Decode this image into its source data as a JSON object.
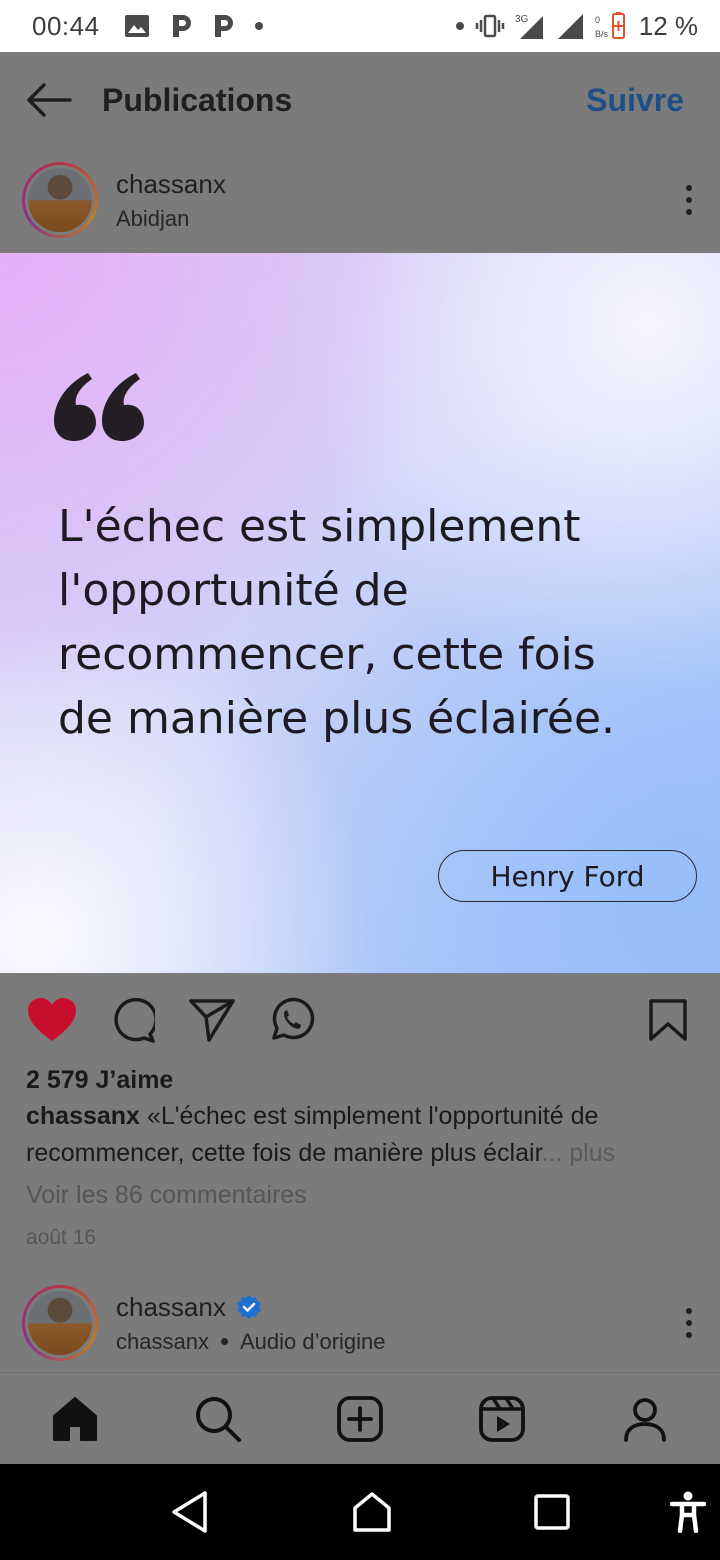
{
  "status_bar": {
    "time": "00:44",
    "battery_percent": "12 %",
    "network": "3G",
    "data_speed": "0 B/s",
    "icons": [
      "gallery-icon",
      "p-app-icon",
      "p-app-icon",
      "dot-icon",
      "vibrate-icon",
      "signal-icon",
      "battery-icon"
    ]
  },
  "header": {
    "title": "Publications",
    "follow_label": "Suivre"
  },
  "post": {
    "username": "chassanx",
    "location": "Abidjan",
    "image": {
      "quote": "L'échec est simplement l'opportunité de recommencer, cette fois de manière plus éclairée.",
      "author": "Henry Ford"
    },
    "likes": "2 579 J’aime",
    "caption_user": "chassanx",
    "caption_text": "«L'échec est simplement l'opportunité de recommencer, cette fois de manière plus éclair",
    "caption_ellipsis": "...",
    "caption_more": " plus",
    "comments_link": "Voir les 86 commentaires",
    "date": "août 16"
  },
  "next_post": {
    "username": "chassanx",
    "sub_user": "chassanx",
    "audio": "Audio d’origine"
  },
  "colors": {
    "follow": "#1e4f86",
    "like": "#c8102e",
    "verified": "#1d6fd1"
  }
}
